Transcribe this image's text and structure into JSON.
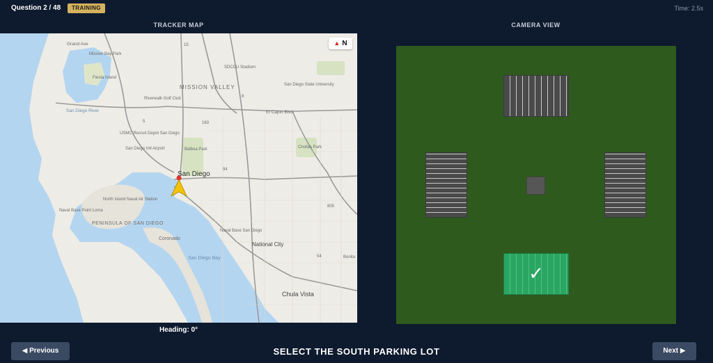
{
  "header": {
    "question": "Question 2 / 48",
    "badge": "TRAINING",
    "timer": "Time: 2.5s"
  },
  "tracker": {
    "title": "TRACKER MAP",
    "north_label": "N",
    "heading": "Heading: 0°",
    "map_labels": {
      "grand_ave": "Grand Ave",
      "mission_bay_park": "Mission Bay Park",
      "fiesta_island": "Fiesta Island",
      "sdccu_stadium": "SDCCU Stadium",
      "mission_valley": "MISSION VALLEY",
      "sdsu": "San Diego State University",
      "riverwalk": "Riverwalk Golf Club",
      "san_diego_river": "San Diego River",
      "el_cajon_blvd": "El Cajon Blvd",
      "usmc": "USMC Recruit Depot San Diego",
      "sd_intl_airport": "San Diego Intl Airport",
      "balboa_park": "Balboa Park",
      "chollas_park": "Chollas Park",
      "san_diego": "San Diego",
      "north_island": "North Island Naval Air Station",
      "naval_base_point_loma": "Naval Base Point Loma",
      "peninsula": "PENINSULA OF SAN DIEGO",
      "coronado": "Coronado",
      "naval_base_sd": "Naval Base San Diego",
      "national_city": "National City",
      "san_diego_bay": "San Diego Bay",
      "chula_vista": "Chula Vista",
      "bonita": "Bonita",
      "road_15": "15",
      "road_8": "8",
      "road_5": "5",
      "road_805": "805",
      "road_94": "94",
      "road_54": "54",
      "road_163": "163"
    }
  },
  "camera": {
    "title": "CAMERA VIEW",
    "selected_check": "✓",
    "colors": {
      "grass": "#2e5a1d",
      "lot": "#4a4a4a",
      "selected_lot": "#2aa562"
    }
  },
  "footer": {
    "previous": "◀ Previous",
    "instruction": "SELECT THE SOUTH PARKING LOT",
    "next": "Next ▶"
  },
  "colors": {
    "background": "#0e1a2e",
    "badge": "#d4b15d",
    "button": "#3b4a63",
    "water": "#b4d5f0",
    "land": "#eeece6",
    "marker": "#f4c300"
  }
}
